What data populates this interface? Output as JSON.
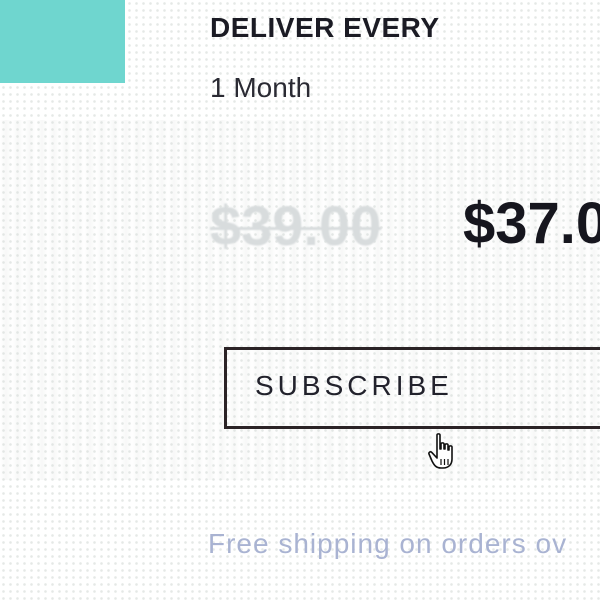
{
  "brand_accent": "#6fd6cf",
  "delivery": {
    "label": "DELIVER EVERY",
    "frequency": "1 Month"
  },
  "pricing": {
    "original_price": "$39.00",
    "subscription_price": "$37.0"
  },
  "actions": {
    "subscribe_label": "SUBSCRIBE"
  },
  "shipping": {
    "note": "Free shipping on orders ov"
  },
  "cursor": {
    "icon": "hand-pointer-icon"
  }
}
